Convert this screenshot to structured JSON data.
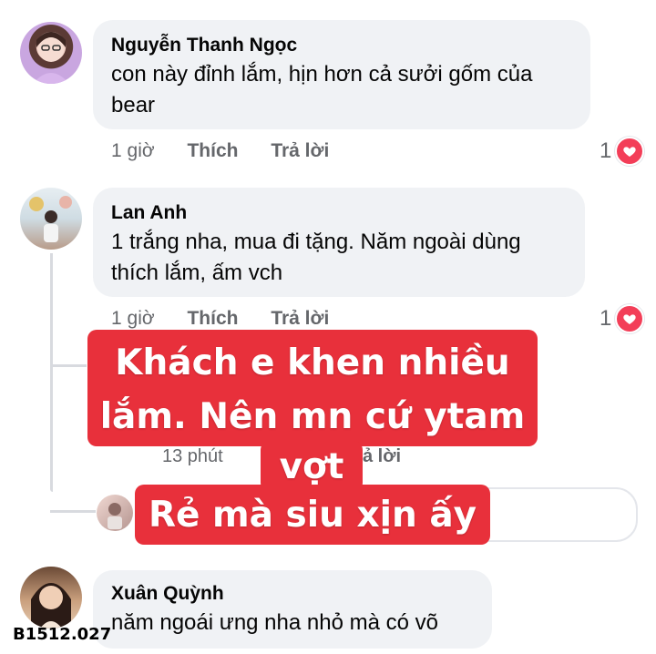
{
  "comments": [
    {
      "name": "Nguyễn Thanh Ngọc",
      "line1": "con này đỉnh lắm, hịn hơn cả sưởi gốm của",
      "line2": "bear",
      "time": "1 giờ",
      "like": "Thích",
      "reply": "Trả lời",
      "reaction_count": "1"
    },
    {
      "name": "Lan Anh",
      "line1": "1 trắng nha, mua đi tặng. Năm ngoài dùng",
      "line2": "thích lắm, ấm vch",
      "time": "1 giờ",
      "like": "Thích",
      "reply": "Trả lời",
      "reaction_count": "1"
    },
    {
      "name": "Xuân Quỳnh",
      "line1": "năm ngoái ưng nha nhỏ mà có võ"
    }
  ],
  "hidden_reply": {
    "time": "13 phút",
    "reply_partial": "ả lời"
  },
  "overlay": {
    "line1": "Khách e khen nhiều",
    "line2": "lắm. Nên mn cứ ytam",
    "line3": "vợt",
    "line4": "Rẻ mà siu xịn ấy"
  },
  "code": "B1512.027",
  "colors": {
    "overlay": "#e8303b",
    "heart": "#f33e58",
    "bubble": "#f0f2f5"
  }
}
